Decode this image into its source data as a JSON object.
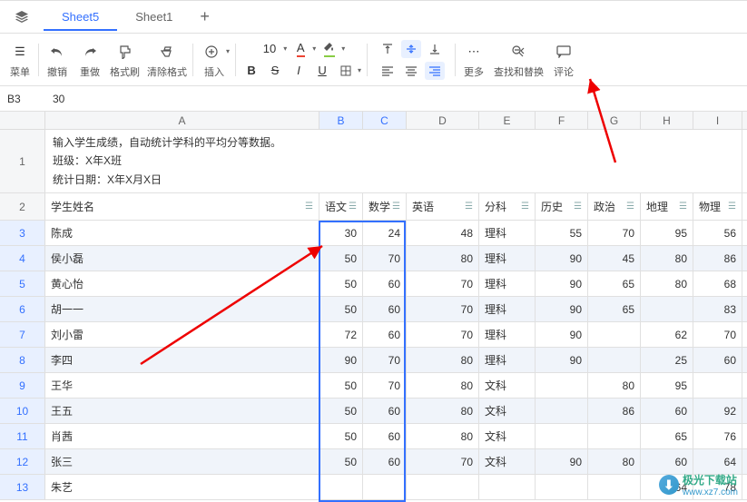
{
  "tabs": {
    "active": "Sheet5",
    "other": "Sheet1"
  },
  "toolbar": {
    "menu": "菜单",
    "undo": "撤销",
    "redo": "重做",
    "format_painter": "格式刷",
    "clear_format": "清除格式",
    "insert": "插入",
    "font_size": "10",
    "more": "更多",
    "find_replace": "查找和替换",
    "comments": "评论"
  },
  "cell_ref": "B3",
  "cell_value": "30",
  "columns": [
    "A",
    "B",
    "C",
    "D",
    "E",
    "F",
    "G",
    "H",
    "I"
  ],
  "row1_text": "输入学生成绩，自动统计学科的平均分等数据。\n班级：X年X班\n统计日期：X年X月X日",
  "headers": {
    "name": "学生姓名",
    "chinese": "语文",
    "math": "数学",
    "english": "英语",
    "track": "分科",
    "history": "历史",
    "politics": "政治",
    "geo": "地理",
    "physics": "物理"
  },
  "chart_data": {
    "type": "table",
    "columns": [
      "学生姓名",
      "语文",
      "数学",
      "英语",
      "分科",
      "历史",
      "政治",
      "地理",
      "物理"
    ],
    "rows": [
      {
        "name": "陈成",
        "chinese": 30,
        "math": 24,
        "english": 48,
        "track": "理科",
        "history": 55,
        "politics": 70,
        "geo": 95,
        "physics": 56
      },
      {
        "name": "侯小磊",
        "chinese": 50,
        "math": 70,
        "english": 80,
        "track": "理科",
        "history": 90,
        "politics": 45,
        "geo": 80,
        "physics": 86
      },
      {
        "name": "黄心怡",
        "chinese": 50,
        "math": 60,
        "english": 70,
        "track": "理科",
        "history": 90,
        "politics": 65,
        "geo": 80,
        "physics": 68
      },
      {
        "name": "胡一一",
        "chinese": 50,
        "math": 60,
        "english": 70,
        "track": "理科",
        "history": 90,
        "politics": 65,
        "geo": "",
        "physics": 83
      },
      {
        "name": "刘小雷",
        "chinese": 72,
        "math": 60,
        "english": 70,
        "track": "理科",
        "history": 90,
        "politics": "",
        "geo": 62,
        "physics": 70
      },
      {
        "name": "李四",
        "chinese": 90,
        "math": 70,
        "english": 80,
        "track": "理科",
        "history": 90,
        "politics": "",
        "geo": 25,
        "physics": 60
      },
      {
        "name": "王华",
        "chinese": 50,
        "math": 70,
        "english": 80,
        "track": "文科",
        "history": "",
        "politics": 80,
        "geo": 95,
        "physics": ""
      },
      {
        "name": "王五",
        "chinese": 50,
        "math": 60,
        "english": 80,
        "track": "文科",
        "history": "",
        "politics": 86,
        "geo": 60,
        "physics": 92
      },
      {
        "name": "肖茜",
        "chinese": 50,
        "math": 60,
        "english": 80,
        "track": "文科",
        "history": "",
        "politics": "",
        "geo": 65,
        "physics": 76
      },
      {
        "name": "张三",
        "chinese": 50,
        "math": 60,
        "english": 70,
        "track": "文科",
        "history": 90,
        "politics": 80,
        "geo": 60,
        "physics": 64
      },
      {
        "name": "朱艺",
        "chinese": "",
        "math": "",
        "english": "",
        "track": "",
        "history": "",
        "politics": "",
        "geo": 64,
        "physics": 78
      }
    ]
  },
  "watermark": {
    "name": "极光下载站",
    "url": "www.xz7.com"
  }
}
